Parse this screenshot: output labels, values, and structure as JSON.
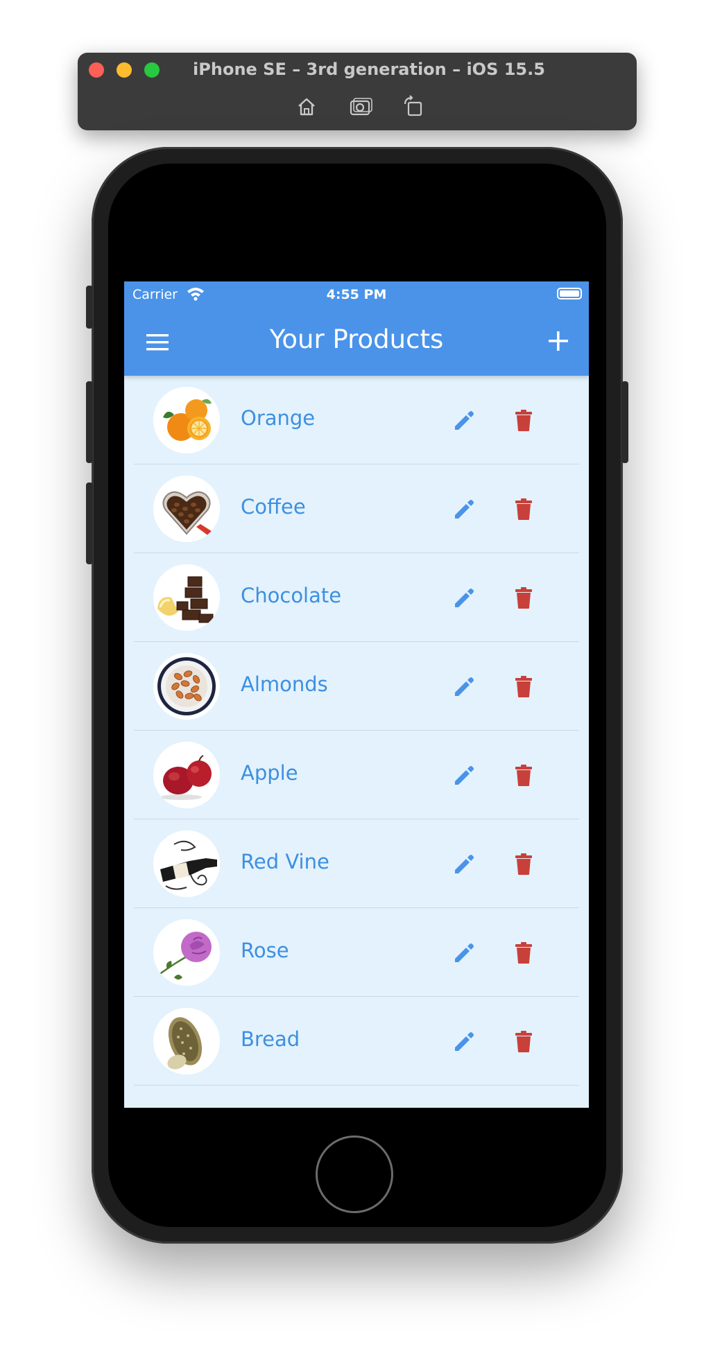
{
  "simulator": {
    "title": "iPhone SE – 3rd generation – iOS 15.5",
    "tools": [
      "home-icon",
      "screenshot-icon",
      "rotate-icon"
    ]
  },
  "status_bar": {
    "carrier": "Carrier",
    "time": "4:55 PM"
  },
  "header": {
    "title": "Your Products",
    "menu_icon": "hamburger-menu-icon",
    "add_icon": "plus-icon"
  },
  "colors": {
    "header_bg": "#4a93e9",
    "list_bg": "#e3f2fd",
    "product_text": "#3d8fe0",
    "edit_icon": "#4a93e9",
    "delete_icon": "#c8403a"
  },
  "products": [
    {
      "name": "Orange",
      "image": "orange-image"
    },
    {
      "name": "Coffee",
      "image": "coffee-beans-image"
    },
    {
      "name": "Chocolate",
      "image": "chocolate-image"
    },
    {
      "name": "Almonds",
      "image": "almonds-image"
    },
    {
      "name": "Apple",
      "image": "apple-image"
    },
    {
      "name": "Red Vine",
      "image": "wine-bottle-image"
    },
    {
      "name": "Rose",
      "image": "rose-image"
    },
    {
      "name": "Bread",
      "image": "bread-image"
    }
  ]
}
